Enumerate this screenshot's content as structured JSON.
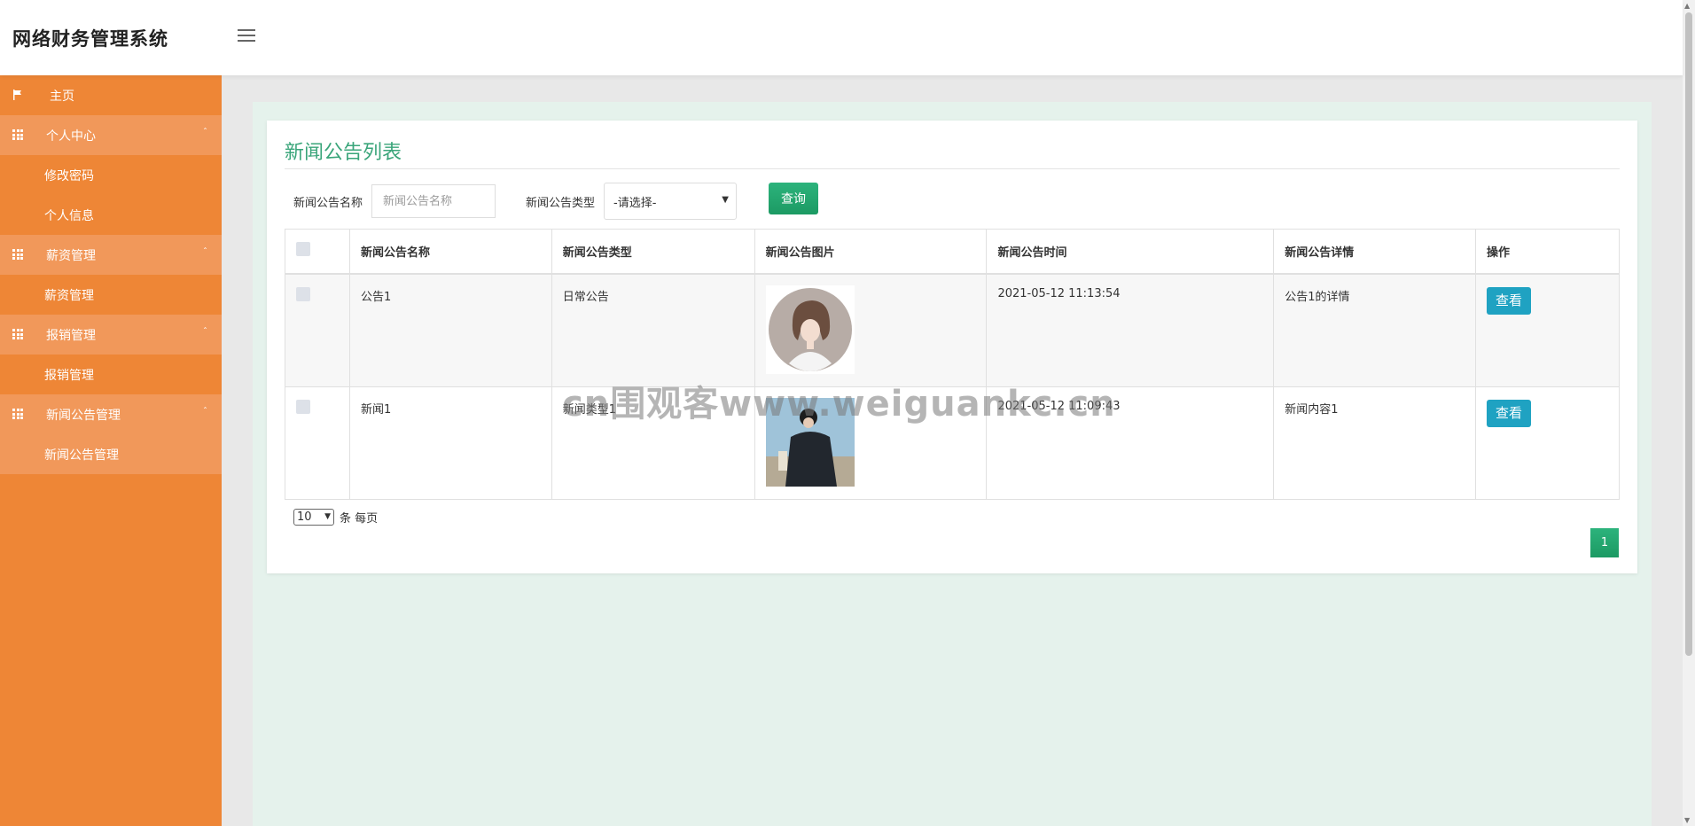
{
  "header": {
    "app_title": "网络财务管理系统",
    "avatar_text": "80x80"
  },
  "sidebar": {
    "items": [
      {
        "label": "主页",
        "icon": "flag-icon",
        "type": "home"
      },
      {
        "label": "个人中心",
        "icon": "grid-icon",
        "type": "parent"
      },
      {
        "label": "修改密码",
        "type": "sub"
      },
      {
        "label": "个人信息",
        "type": "sub"
      },
      {
        "label": "薪资管理",
        "icon": "grid-icon",
        "type": "parent"
      },
      {
        "label": "薪资管理",
        "type": "sub"
      },
      {
        "label": "报销管理",
        "icon": "grid-icon",
        "type": "parent"
      },
      {
        "label": "报销管理",
        "type": "sub"
      },
      {
        "label": "新闻公告管理",
        "icon": "grid-icon",
        "type": "parent"
      },
      {
        "label": "新闻公告管理",
        "type": "sub",
        "active": true
      }
    ],
    "caret": "ˆ"
  },
  "main": {
    "title": "新闻公告列表",
    "search": {
      "name_label": "新闻公告名称",
      "name_placeholder": "新闻公告名称",
      "type_label": "新闻公告类型",
      "type_selected": "-请选择-",
      "query_button": "查询"
    },
    "table": {
      "headers": [
        "新闻公告名称",
        "新闻公告类型",
        "新闻公告图片",
        "新闻公告时间",
        "新闻公告详情",
        "操作"
      ],
      "rows": [
        {
          "name": "公告1",
          "type": "日常公告",
          "time": "2021-05-12 11:13:54",
          "detail": "公告1的详情",
          "action": "查看"
        },
        {
          "name": "新闻1",
          "type": "新闻类型1",
          "time": "2021-05-12 11:09:43",
          "detail": "新闻内容1",
          "action": "查看"
        }
      ]
    },
    "pagination": {
      "page_size": "10",
      "per_page_label": "条 每页",
      "current_page": "1"
    }
  },
  "watermark": "cn围观客www.weiguankc.cn",
  "colors": {
    "sidebar": "#ee8636",
    "sidebar_highlight": "#f1985a",
    "accent_green": "#2cb37c",
    "view_button": "#1fa2c2",
    "content_bg": "#e5f2ec"
  }
}
